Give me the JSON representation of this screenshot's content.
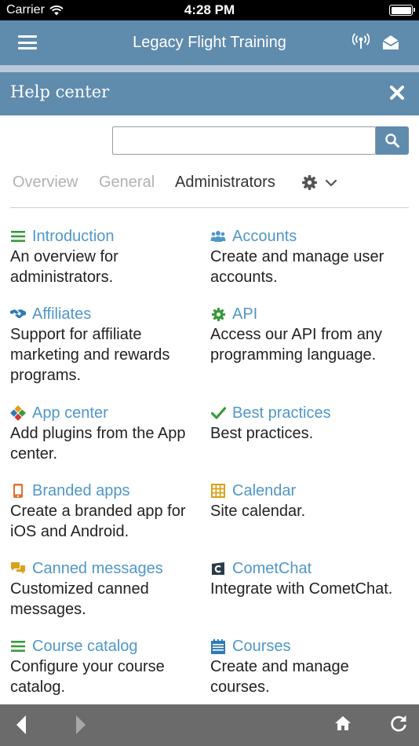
{
  "status_bar": {
    "carrier": "Carrier",
    "time": "4:28 PM"
  },
  "app_bar": {
    "title": "Legacy Flight Training",
    "menu_icon": "hamburger-menu-icon",
    "signal_icon": "broadcast-icon",
    "mail_icon": "envelope-icon"
  },
  "help_center": {
    "title": "Help center",
    "close_icon": "close-icon"
  },
  "search": {
    "value": "",
    "placeholder": "",
    "button_icon": "search-icon"
  },
  "tabs": [
    {
      "label": "Overview",
      "active": false
    },
    {
      "label": "General",
      "active": false
    },
    {
      "label": "Administrators",
      "active": true
    }
  ],
  "tab_menu_icons": [
    "gear-icon",
    "chevron-down-icon"
  ],
  "topics": [
    {
      "title": "Introduction",
      "description": "An overview for administrators.",
      "icon": "list-icon"
    },
    {
      "title": "Accounts",
      "description": "Create and manage user accounts.",
      "icon": "users-icon"
    },
    {
      "title": "Affiliates",
      "description": "Support for affiliate marketing and rewards programs.",
      "icon": "handshake-icon"
    },
    {
      "title": "API",
      "description": "Access our API from any programming language.",
      "icon": "cog-icon"
    },
    {
      "title": "App center",
      "description": "Add plugins from the App center.",
      "icon": "app-grid-icon"
    },
    {
      "title": "Best practices",
      "description": "Best practices.",
      "icon": "checkmark-icon"
    },
    {
      "title": "Branded apps",
      "description": "Create a branded app for iOS and Android.",
      "icon": "mobile-phone-icon"
    },
    {
      "title": "Calendar",
      "description": "Site calendar.",
      "icon": "calendar-grid-icon"
    },
    {
      "title": "Canned messages",
      "description": "Customized canned messages.",
      "icon": "chat-bubbles-icon"
    },
    {
      "title": "CometChat",
      "description": "Integrate with CometChat.",
      "icon": "cometchat-icon"
    },
    {
      "title": "Course catalog",
      "description": "Configure your course catalog.",
      "icon": "list-icon"
    },
    {
      "title": "Courses",
      "description": "Create and manage courses.",
      "icon": "calendar-list-icon"
    }
  ],
  "bottom_bar": {
    "icons": [
      "back-arrow-icon",
      "forward-arrow-icon",
      "home-icon",
      "refresh-icon"
    ]
  },
  "colors": {
    "header": "#5f8bad",
    "link": "#4f97c7",
    "green": "#3a9a3a",
    "bottom_bar": "#6b6b6b"
  }
}
